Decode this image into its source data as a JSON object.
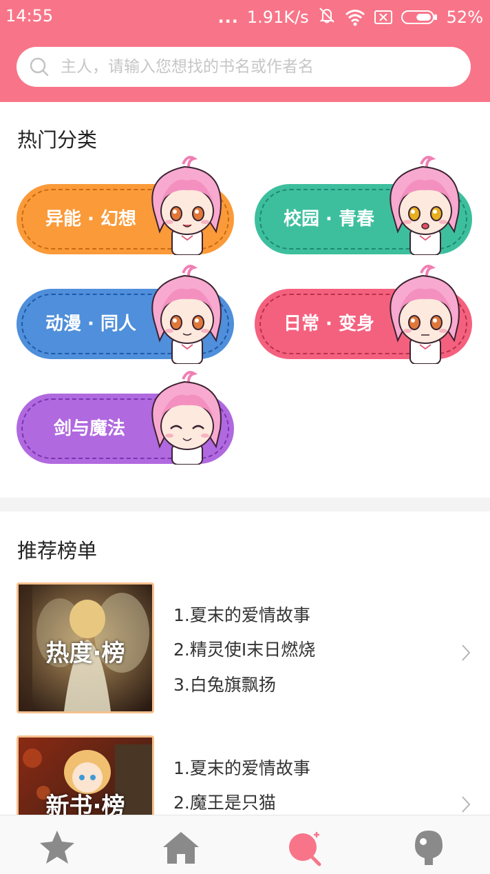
{
  "status_bar": {
    "time": "14:55",
    "dots": "...",
    "network_speed": "1.91K/s",
    "battery_percent": "52%",
    "battery_level": 0.52
  },
  "search": {
    "placeholder": "主人，请输入您想找的书名或作者名"
  },
  "sections": {
    "hot_categories": "热门分类",
    "recommended_lists": "推荐榜单"
  },
  "categories": [
    {
      "label": "异能 · 幻想",
      "color": "#fb9a39",
      "dash_color": "#c96a10"
    },
    {
      "label": "校园 · 青春",
      "color": "#3dbf9e",
      "dash_color": "#1d8a6e"
    },
    {
      "label": "动漫 · 同人",
      "color": "#4f8fdb",
      "dash_color": "#1f5aa6"
    },
    {
      "label": "日常 · 变身",
      "color": "#f4617e",
      "dash_color": "#b8304a"
    },
    {
      "label": "剑与魔法",
      "color": "#b069df",
      "dash_color": "#7a34b0"
    }
  ],
  "rankings": [
    {
      "cover_title": "热度·榜",
      "items": [
        "1.夏末的爱情故事",
        "2.精灵使Ⅰ末日燃烧",
        "3.白兔旗飘扬"
      ]
    },
    {
      "cover_title": "新书·榜",
      "items": [
        "1.夏末的爱情故事",
        "2.魔王是只猫"
      ]
    }
  ],
  "nav": {
    "items": [
      "star-icon",
      "home-icon",
      "discover-icon",
      "profile-icon"
    ],
    "active_color": "#f87589",
    "inactive_color": "#8a8a8a"
  }
}
